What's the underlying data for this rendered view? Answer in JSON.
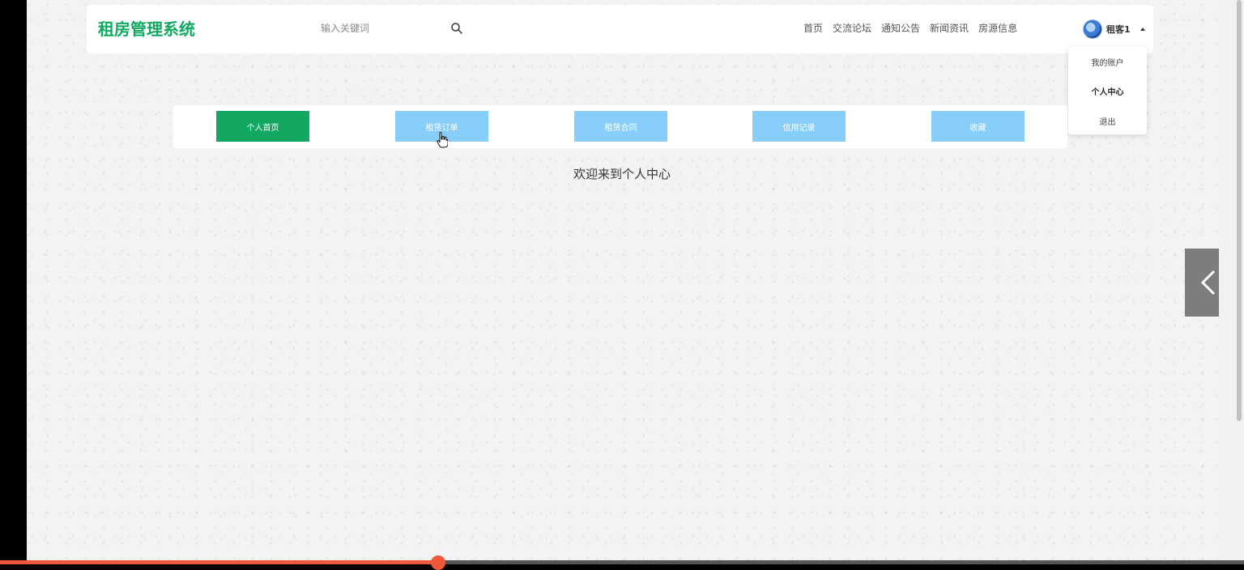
{
  "header": {
    "logo": "租房管理系统",
    "search_placeholder": "输入关键词",
    "nav_items": [
      "首页",
      "交流论坛",
      "通知公告",
      "新闻资讯",
      "房源信息"
    ],
    "username": "租客1"
  },
  "user_menu": {
    "items": [
      "我的账户",
      "个人中心",
      "退出"
    ],
    "active": "个人中心"
  },
  "tabs": [
    {
      "label": "个人首页",
      "active": true
    },
    {
      "label": "租赁订单",
      "active": false
    },
    {
      "label": "租赁合同",
      "active": false
    },
    {
      "label": "信用记录",
      "active": false
    },
    {
      "label": "收藏",
      "active": false
    }
  ],
  "main": {
    "welcome": "欢迎来到个人中心"
  },
  "colors": {
    "brand": "#13a862",
    "tab_inactive": "#87cefa",
    "progress": "#f0583a"
  },
  "video_progress": 0.35
}
